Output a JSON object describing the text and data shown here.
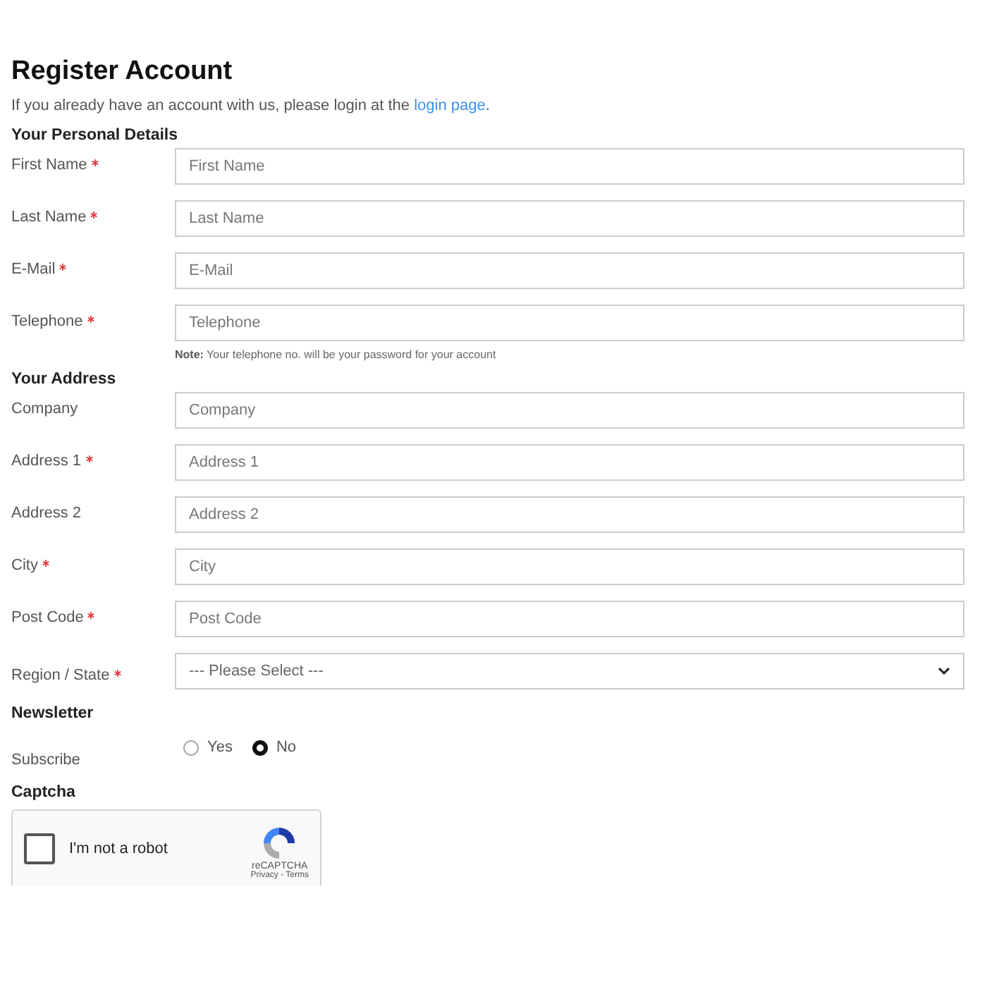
{
  "title": "Register Account",
  "intro": {
    "text": "If you already have an account with us, please login at the ",
    "link": "login page",
    "after": "."
  },
  "sections": [
    {
      "heading": "Your Personal Details",
      "fields": [
        {
          "label": "First Name",
          "required": true,
          "kind": "text",
          "placeholder": "First Name"
        },
        {
          "label": "Last Name",
          "required": true,
          "kind": "text",
          "placeholder": "Last Name"
        },
        {
          "label": "E-Mail",
          "required": true,
          "kind": "text",
          "placeholder": "E-Mail"
        },
        {
          "label": "Telephone",
          "required": true,
          "kind": "text",
          "placeholder": "Telephone",
          "note": "**Note:** Your telephone no. will be your password for your account"
        }
      ]
    },
    {
      "heading": "Your Address",
      "fields": [
        {
          "label": "Company",
          "required": false,
          "kind": "text",
          "placeholder": "Company"
        },
        {
          "label": "Address 1",
          "required": true,
          "kind": "text",
          "placeholder": "Address 1"
        },
        {
          "label": "Address 2",
          "required": false,
          "kind": "text",
          "placeholder": "Address 2"
        },
        {
          "label": "City",
          "required": true,
          "kind": "text",
          "placeholder": "City"
        },
        {
          "label": "Post Code",
          "required": true,
          "kind": "text",
          "placeholder": "Post Code"
        },
        {
          "label": "Region / State",
          "required": true,
          "kind": "select",
          "value": "--- Please Select ---"
        }
      ]
    },
    {
      "heading": "Newsletter",
      "fields": [
        {
          "label": "Subscribe",
          "required": false,
          "kind": "radio",
          "options": [
            {
              "label": "Yes",
              "selected": false
            },
            {
              "label": "No",
              "selected": true
            }
          ]
        }
      ]
    }
  ],
  "captcha": {
    "heading": "Captcha",
    "label": "I'm not a robot",
    "checked": false,
    "brand": "reCAPTCHA",
    "privacy": "Privacy",
    "separator": "-",
    "terms": "Terms"
  }
}
